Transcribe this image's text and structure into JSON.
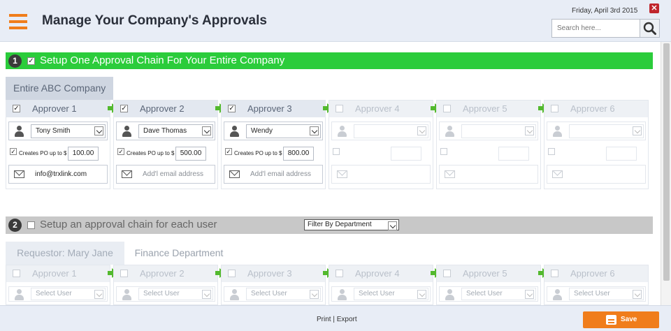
{
  "header": {
    "title": "Manage Your Company's Approvals",
    "date": "Friday, April 3rd 2015",
    "close_icon": "close-icon",
    "search": {
      "placeholder": "Search here...",
      "value": ""
    }
  },
  "section1": {
    "number": "1",
    "checked": true,
    "label": "Setup One Approval Chain For Your Entire Company",
    "tab": "Entire ABC Company",
    "approvers": [
      {
        "label": "Approver 1",
        "checked": true,
        "user": "Tony Smith",
        "po_checked": true,
        "po_label": "Creates PO up to $",
        "po_value": "100.00",
        "email": "info@trxlink.com",
        "email_placeholder": ""
      },
      {
        "label": "Approver 2",
        "checked": true,
        "user": "Dave Thomas",
        "po_checked": true,
        "po_label": "Creates PO up to $",
        "po_value": "500.00",
        "email": "",
        "email_placeholder": "Add'l email address"
      },
      {
        "label": "Approver 3",
        "checked": true,
        "user": "Wendy",
        "po_checked": true,
        "po_label": "Creates PO up to $",
        "po_value": "800.00",
        "email": "",
        "email_placeholder": "Add'l email address"
      },
      {
        "label": "Approver 4",
        "checked": false,
        "user": "",
        "po_checked": false,
        "po_label": "",
        "po_value": "",
        "email": "",
        "email_placeholder": ""
      },
      {
        "label": "Approver 5",
        "checked": false,
        "user": "",
        "po_checked": false,
        "po_label": "",
        "po_value": "",
        "email": "",
        "email_placeholder": ""
      },
      {
        "label": "Approver 6",
        "checked": false,
        "user": "",
        "po_checked": false,
        "po_label": "",
        "po_value": "",
        "email": "",
        "email_placeholder": ""
      }
    ]
  },
  "section2": {
    "number": "2",
    "checked": false,
    "label": "Setup an approval chain for each user",
    "filter": "Filter By Department",
    "tabs": [
      "Requestor: Mary Jane",
      "Finance Department"
    ],
    "approvers": [
      {
        "label": "Approver 1",
        "user_placeholder": "Select User"
      },
      {
        "label": "Approver 2",
        "user_placeholder": "Select User"
      },
      {
        "label": "Approver 3",
        "user_placeholder": "Select User"
      },
      {
        "label": "Approver 4",
        "user_placeholder": "Select User"
      },
      {
        "label": "Approver 5",
        "user_placeholder": "Select User"
      },
      {
        "label": "Approver 6",
        "user_placeholder": "Select User"
      }
    ]
  },
  "footer": {
    "print": "Print",
    "separator": "|",
    "export": "Export",
    "save": "Save"
  },
  "colors": {
    "accent_orange": "#f07d1b",
    "section1_green": "#2bcc3b",
    "arrow_green": "#53b92e",
    "header_bg": "#e8edf6",
    "close_red": "#c0262d"
  }
}
